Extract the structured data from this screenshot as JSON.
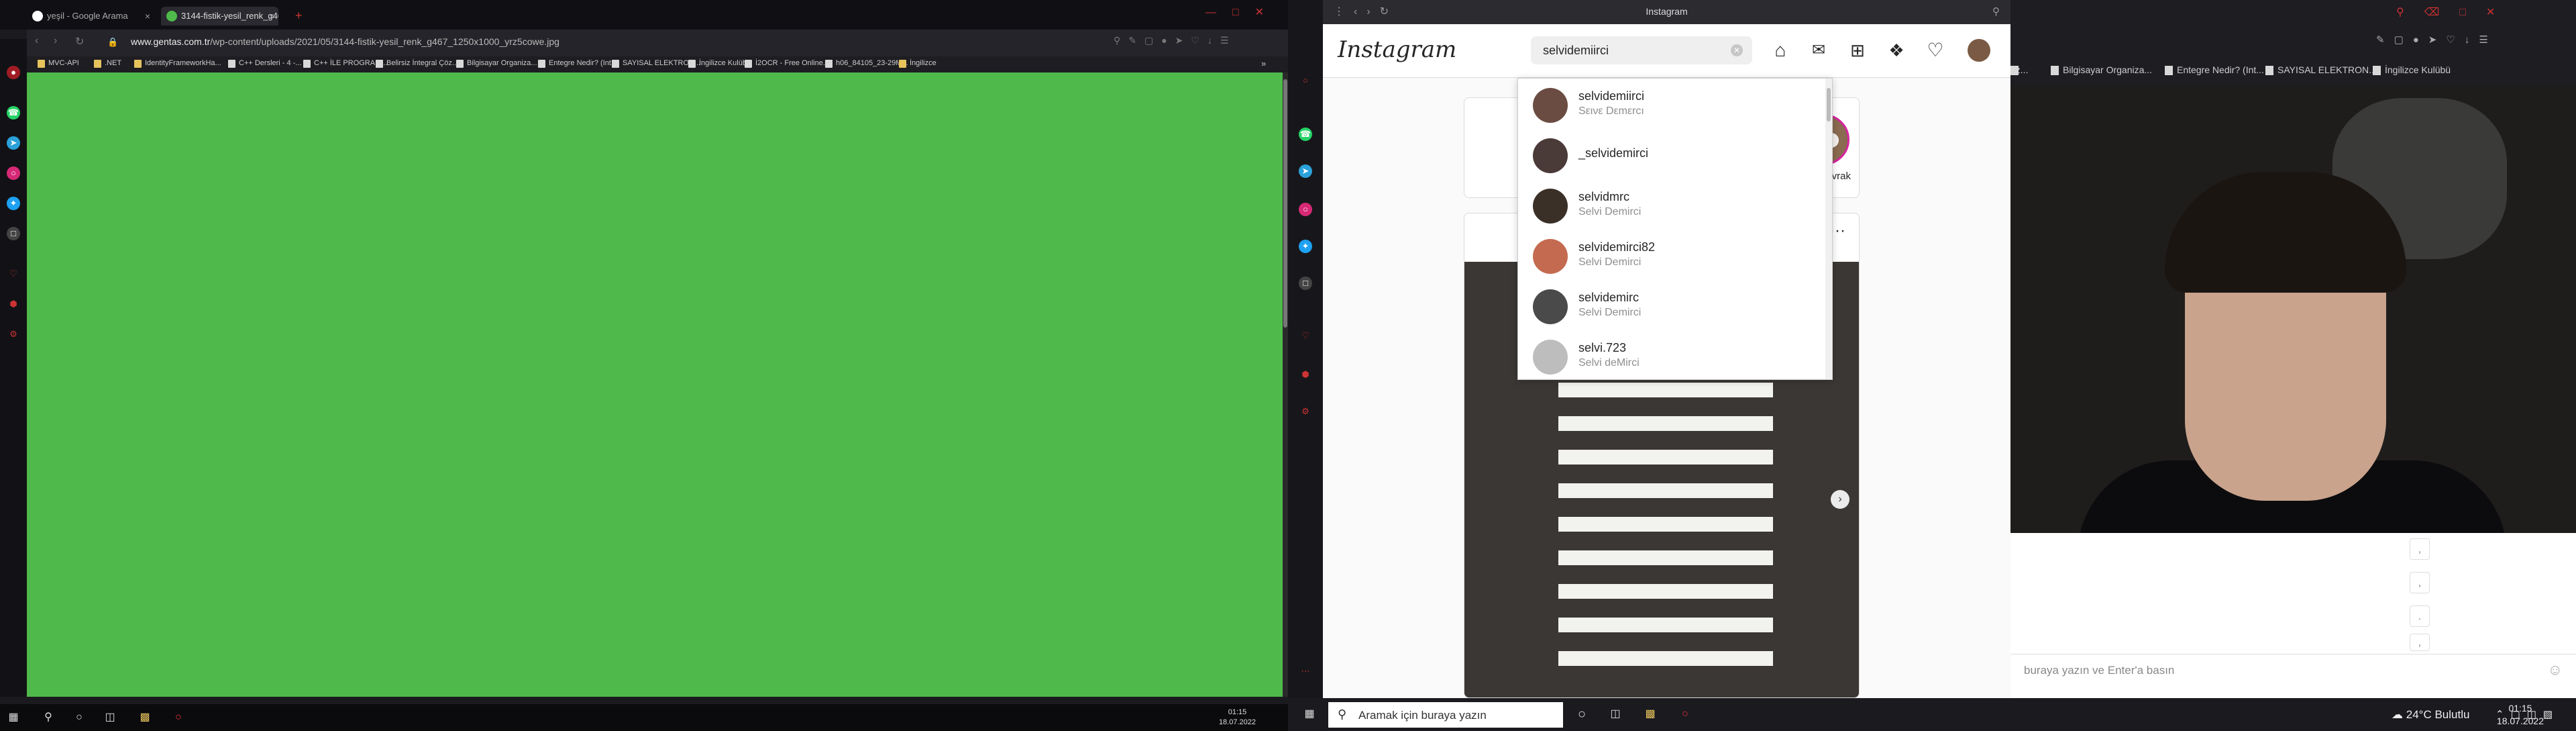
{
  "left": {
    "tabs": [
      {
        "label": "yeşil - Google Arama",
        "close": "×"
      },
      {
        "label": "3144-fistik-yesil_renk_g467_...",
        "close": "×"
      }
    ],
    "new_tab": "+",
    "url": {
      "host": "www.gentas.com.tr",
      "path": "/wp-content/uploads/2021/05/3144-fistik-yesil_renk_g467_1250x1000_yrz5cowe.jpg"
    },
    "bookmarks": [
      "MVC-API",
      ".NET",
      "IdentityFrameworkHa...",
      "C++ Dersleri - 4 -...",
      "C++ İLE PROGRAM...",
      "Belirsiz İntegral Çöz...",
      "Bilgisayar Organiza...",
      "Entegre Nedir? (Int...",
      "SAYISAL ELEKTRON...",
      "İngilizce Kulübü",
      "İ2OCR - Free Online...",
      "h06_84105_23-29M...",
      "İngilizce"
    ],
    "more_bookmarks": "»",
    "clock": {
      "time": "01:15",
      "date": "18.07.2022"
    },
    "colors": {
      "image": "#4fba4b"
    }
  },
  "instagram": {
    "window_title": "Instagram",
    "logo": "Instagram",
    "search_value": "selvidemiirci",
    "results": [
      {
        "username": "selvidemiirci",
        "name": "Sεινε Dεmεrcı"
      },
      {
        "username": "_selvidemirci",
        "name": ""
      },
      {
        "username": "selvidmrc",
        "name": "Selvi Demirci"
      },
      {
        "username": "selvidemirci82",
        "name": "Selvi Demirci"
      },
      {
        "username": "selvidemirc",
        "name": "Selvi Demirci"
      },
      {
        "username": "selvi.723",
        "name": "Selvi deMirci"
      }
    ],
    "story_label": "koraykıvrak",
    "post_more": "···"
  },
  "right": {
    "bookmarks": [
      "öz...",
      "Bilgisayar Organiza...",
      "Entegre Nedir? (Int...",
      "SAYISAL ELEKTRON...",
      "İngilizce Kulübü"
    ],
    "chat_placeholder": "buraya yazın ve Enter'a basın",
    "chat_buttons": [
      ",",
      ",",
      ".",
      ","
    ],
    "taskbar_search": "Aramak için buraya yazın",
    "weather": "24°C  Bulutlu",
    "clock": {
      "time": "01:15",
      "date": "18.07.2022"
    }
  }
}
